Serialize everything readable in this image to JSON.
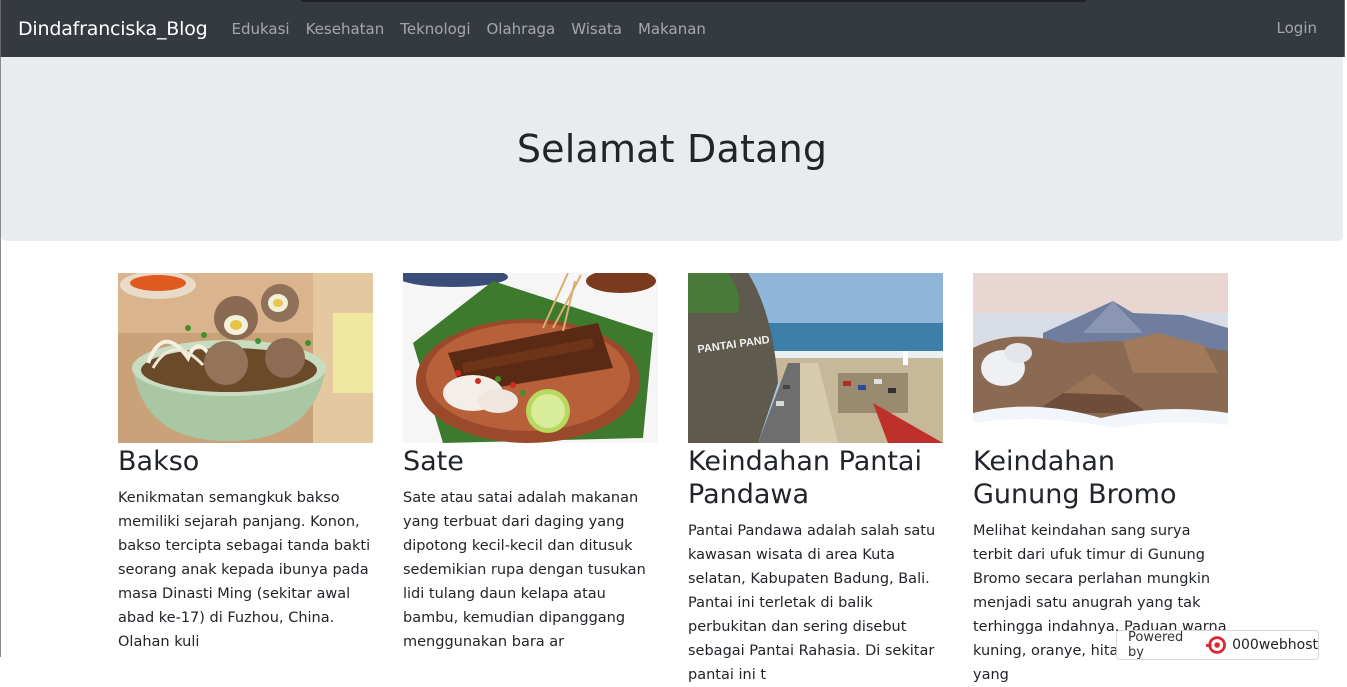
{
  "navbar": {
    "brand": "Dindafranciska_Blog",
    "links": [
      "Edukasi",
      "Kesehatan",
      "Teknologi",
      "Olahraga",
      "Wisata",
      "Makanan"
    ],
    "login": "Login"
  },
  "hero": {
    "title": "Selamat Datang"
  },
  "cards": [
    {
      "title": "Bakso",
      "text": "Kenikmatan semangkuk bakso memiliki sejarah panjang. Konon, bakso tercipta sebagai tanda bakti seorang anak kepada ibunya pada masa Dinasti Ming (sekitar awal abad ke-17) di Fuzhou, China. Olahan kuli",
      "image_icon": "bakso-photo"
    },
    {
      "title": "Sate",
      "text": "Sate atau satai adalah makanan yang terbuat dari daging yang dipotong kecil-kecil dan ditusuk sedemikian rupa dengan tusukan lidi tulang daun kelapa atau bambu, kemudian dipanggang menggunakan bara ar",
      "image_icon": "sate-photo"
    },
    {
      "title": "Keindahan Pantai Pandawa",
      "text": "Pantai Pandawa adalah salah satu kawasan wisata di area Kuta selatan, Kabupaten Badung, Bali. Pantai ini terletak di balik perbukitan dan sering disebut sebagai Pantai Rahasia. Di sekitar pantai ini t",
      "image_icon": "pandawa-beach-photo"
    },
    {
      "title": "Keindahan Gunung Bromo",
      "text": "Melihat keindahan sang surya terbit dari ufuk timur di Gunung Bromo secara perlahan mungkin menjadi satu anugrah yang tak terhingga indahnya. Paduan warna kuning, oranye, hitam dan biru yang",
      "image_icon": "bromo-mountain-photo"
    }
  ],
  "badge": {
    "powered_by": "Powered by",
    "name": "000webhost"
  },
  "colors": {
    "navbar": "#343a40",
    "hero": "#e9ecef",
    "text": "#212529"
  }
}
